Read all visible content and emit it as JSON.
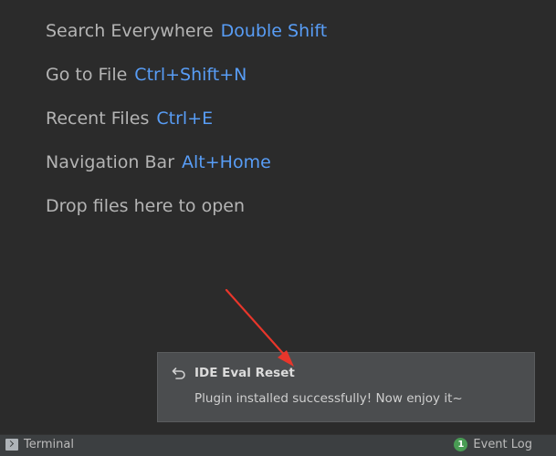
{
  "editor": {
    "hints": [
      {
        "label": "Search Everywhere",
        "shortcut": "Double Shift"
      },
      {
        "label": "Go to File",
        "shortcut": "Ctrl+Shift+N"
      },
      {
        "label": "Recent Files",
        "shortcut": "Ctrl+E"
      },
      {
        "label": "Navigation Bar",
        "shortcut": "Alt+Home"
      },
      {
        "label": "Drop files here to open",
        "shortcut": ""
      }
    ]
  },
  "notification": {
    "icon": "undo-icon",
    "title": "IDE Eval Reset",
    "message": "Plugin installed successfully! Now enjoy it~"
  },
  "statusbar": {
    "terminal_label": "Terminal",
    "terminal_icon": "terminal-icon",
    "event_count": "1",
    "event_log_label": "Event Log"
  },
  "colors": {
    "editor_bg": "#2b2b2b",
    "hint_text": "#b4b4b4",
    "shortcut": "#589df6",
    "notification_bg": "#4b4d4f",
    "statusbar_bg": "#3c3f41",
    "annotation_arrow": "#e8362b",
    "event_badge": "#499c54"
  }
}
